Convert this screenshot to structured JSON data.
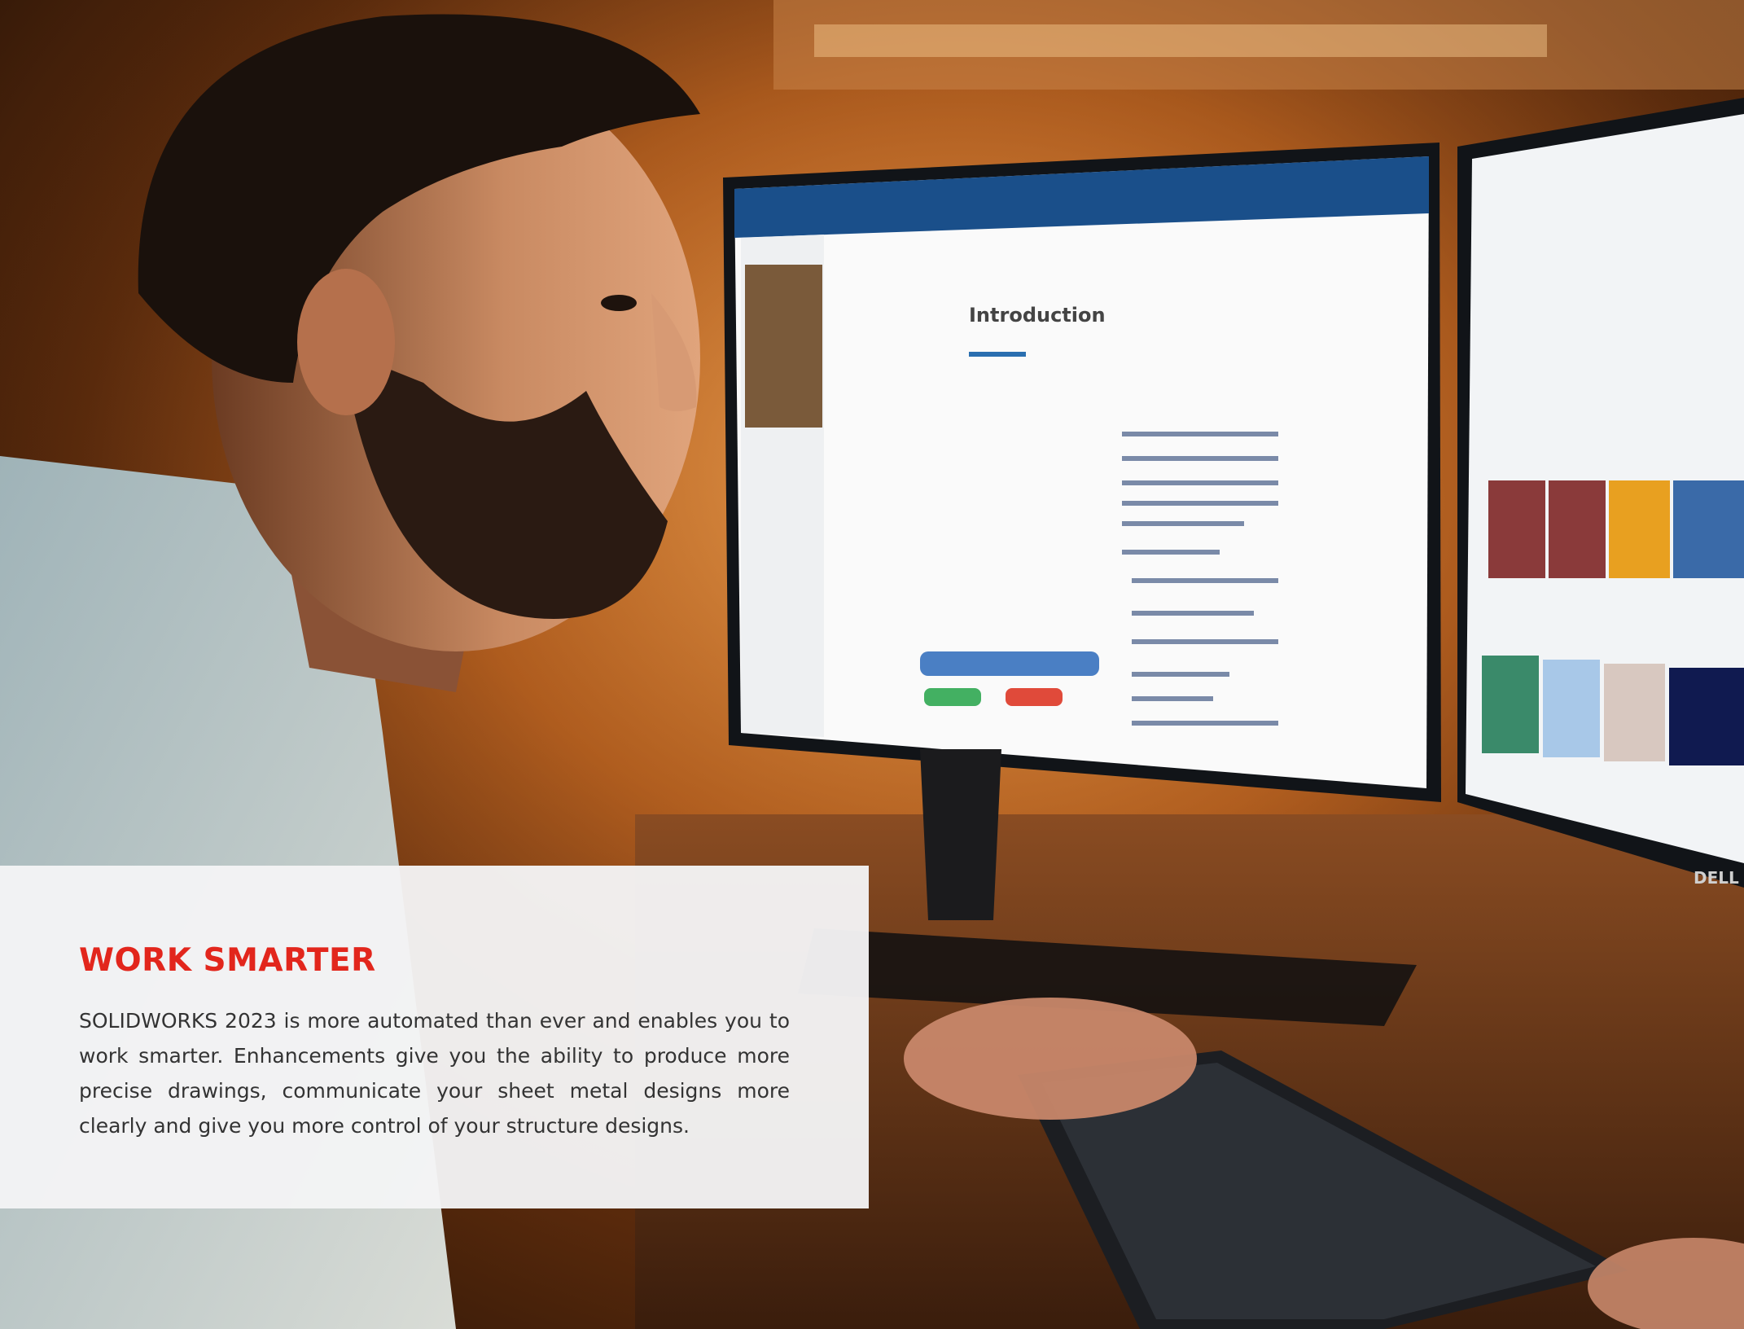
{
  "photo": {
    "description_icon": "photo-person-at-monitors",
    "monitor_left_title": "Introduction",
    "monitor_brand": "DELL"
  },
  "panel": {
    "title": "WORK SMARTER",
    "body": "SOLIDWORKS 2023 is more automated than ever and enables you to work smarter. Enhancements give you the ability to produce more precise drawings, communicate your sheet metal designs more clearly and give you more control of your structure designs."
  },
  "colors": {
    "title_red": "#e2261c",
    "panel_bg": "#f4f4f5",
    "body_text": "#333333"
  }
}
